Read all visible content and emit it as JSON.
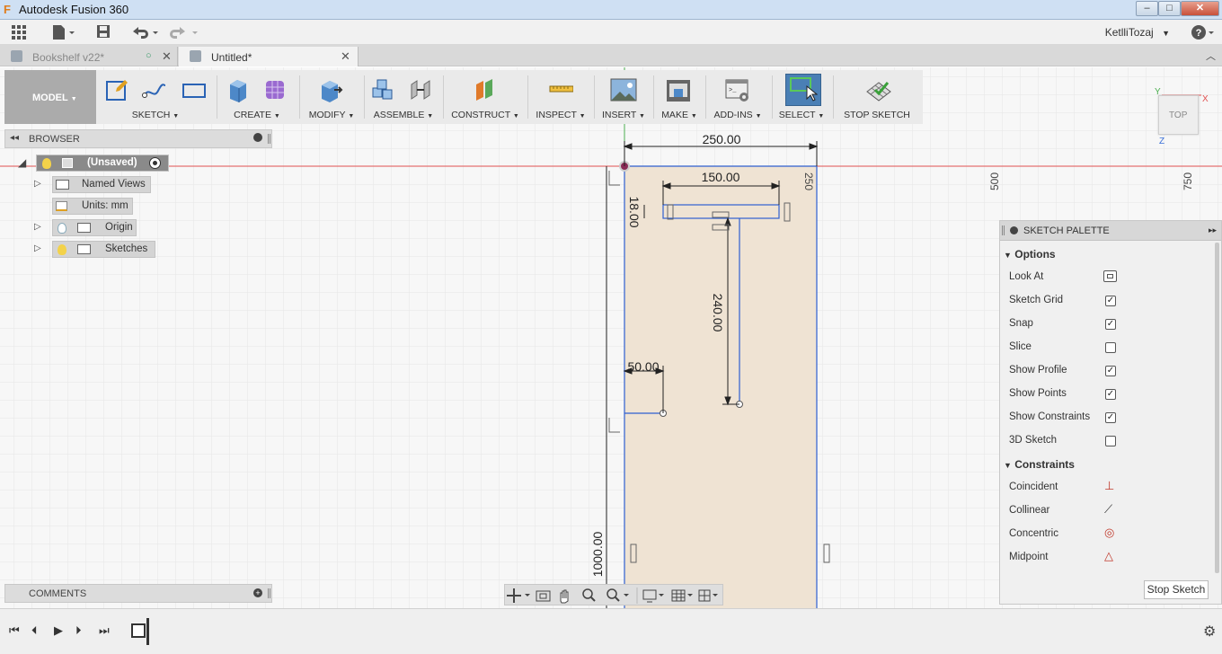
{
  "window": {
    "title": "Autodesk Fusion 360",
    "controls": [
      "minimize-icon",
      "maximize-icon",
      "close-icon"
    ]
  },
  "appbar": {
    "user": "KetlliTozaj"
  },
  "tabs": [
    {
      "label": "Bookshelf v22*",
      "active": false
    },
    {
      "label": "Untitled*",
      "active": true
    }
  ],
  "toolbar": {
    "workspace": "MODEL",
    "groups": [
      {
        "label": "SKETCH"
      },
      {
        "label": "CREATE"
      },
      {
        "label": "MODIFY"
      },
      {
        "label": "ASSEMBLE"
      },
      {
        "label": "CONSTRUCT"
      },
      {
        "label": "INSPECT"
      },
      {
        "label": "INSERT"
      },
      {
        "label": "MAKE"
      },
      {
        "label": "ADD-INS"
      },
      {
        "label": "SELECT"
      },
      {
        "label": "STOP SKETCH"
      }
    ]
  },
  "browser": {
    "title": "BROWSER",
    "root": "(Unsaved)",
    "nodes": [
      {
        "label": "Named Views"
      },
      {
        "label": "Units: mm"
      },
      {
        "label": "Origin"
      },
      {
        "label": "Sketches"
      }
    ]
  },
  "comments": {
    "title": "COMMENTS"
  },
  "sketch": {
    "dims": {
      "width_top": "250.00",
      "inner_width": "150.00",
      "thickness": "18.00",
      "depth": "240.00",
      "offset": "50.00",
      "height": "1000.00"
    },
    "axis_ticks": [
      "250",
      "500",
      "750"
    ]
  },
  "viewcube": {
    "label": "TOP"
  },
  "palette": {
    "title": "SKETCH PALETTE",
    "options_title": "Options",
    "options": [
      {
        "label": "Look At",
        "type": "icon"
      },
      {
        "label": "Sketch Grid",
        "checked": true
      },
      {
        "label": "Snap",
        "checked": true
      },
      {
        "label": "Slice",
        "checked": false
      },
      {
        "label": "Show Profile",
        "checked": true
      },
      {
        "label": "Show Points",
        "checked": true
      },
      {
        "label": "Show Constraints",
        "checked": true
      },
      {
        "label": "3D Sketch",
        "checked": false
      }
    ],
    "constraints_title": "Constraints",
    "constraints": [
      {
        "label": "Coincident",
        "icon": "coincident-icon"
      },
      {
        "label": "Collinear",
        "icon": "collinear-icon"
      },
      {
        "label": "Concentric",
        "icon": "concentric-icon"
      },
      {
        "label": "Midpoint",
        "icon": "midpoint-icon"
      }
    ],
    "stop_button": "Stop Sketch"
  },
  "colors": {
    "accent": "#4a7fb5",
    "sketch_line": "#2f5fd0",
    "profile_fill": "#efe3d3",
    "axis_red": "#e05050"
  }
}
